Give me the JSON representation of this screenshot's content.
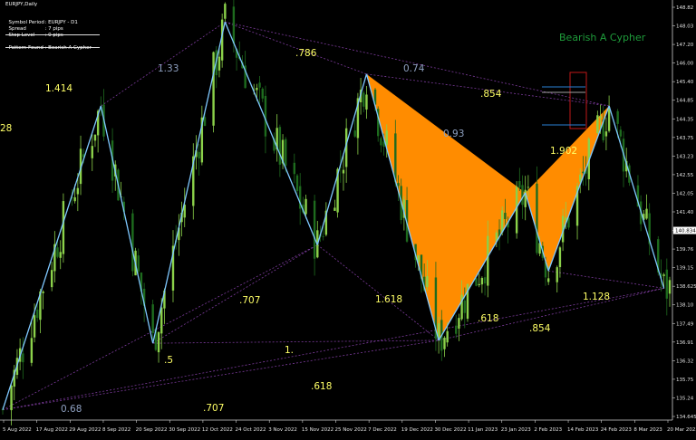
{
  "window": {
    "symbol_title": "EURJPY,Daily"
  },
  "info_panel": {
    "line1_label": "Symbol Period",
    "line1_value": ": EURJPY - D1",
    "line2_label": "Spread",
    "line2_value": ": 7 pips",
    "line3_label": "Stop Level",
    "line3_value": ": 0 pips",
    "line4_label": "Pattern Found",
    "line4_value": ": Bearish A Cypher"
  },
  "pattern_title": "Bearish A Cypher",
  "colors": {
    "background": "#000000",
    "candle_up": "#8bd14a",
    "candle_down": "#1e6b1e",
    "zigzag": "#7fc8ff",
    "pattern_fill": "#ff8c00",
    "fib_label": "#ffff66",
    "ratio_gray": "#8ea0c0",
    "dotted_line": "#7a3a9a",
    "title_green": "#1e9b3a"
  },
  "chart_data": {
    "type": "candlestick",
    "symbol": "EURJPY",
    "timeframe": "Daily",
    "ylim": [
      134.645,
      149.16
    ],
    "y_ticks": [
      148.82,
      148.03,
      147.2,
      146.0,
      145.4,
      144.85,
      144.35,
      143.75,
      143.23,
      142.55,
      142.05,
      141.4,
      140.834,
      139.76,
      139.15,
      138.625,
      138.1,
      137.49,
      136.91,
      136.32,
      135.75,
      135.24,
      134.645
    ],
    "y_tick_labels": [
      "148.82",
      "148.03",
      "147.20",
      "146.00",
      "145.40",
      "144.85",
      "144.35",
      "143.75",
      "143.23",
      "142.55",
      "142.05",
      "141.40",
      "140.834",
      "139.76",
      "139.15",
      "138.625",
      "138.10",
      "137.49",
      "136.91",
      "136.32",
      "135.75",
      "135.24",
      "134.645"
    ],
    "current_price": "140.834",
    "x_labels": [
      "5 Aug 2022",
      "17 Aug 2022",
      "29 Aug 2022",
      "8 Sep 2022",
      "20 Sep 2022",
      "30 Sep 2022",
      "12 Oct 2022",
      "24 Oct 2022",
      "3 Nov 2022",
      "15 Nov 2022",
      "25 Nov 2022",
      "7 Dec 2022",
      "19 Dec 2022",
      "30 Dec 2022",
      "11 Jan 2023",
      "23 Jan 2023",
      "2 Feb 2023",
      "14 Feb 2023",
      "24 Feb 2023",
      "8 Mar 2023",
      "20 Mar 2023"
    ],
    "zigzag": [
      {
        "date": "5 Aug 2022",
        "price": 135.0
      },
      {
        "date": "8 Sep 2022",
        "price": 145.5
      },
      {
        "date": "26 Sep 2022",
        "price": 137.3
      },
      {
        "date": "21 Oct 2022",
        "price": 148.4
      },
      {
        "date": "22 Nov 2022",
        "price": 140.7
      },
      {
        "date": "9 Dec 2022",
        "price": 146.6
      },
      {
        "date": "3 Jan 2023",
        "price": 137.4
      },
      {
        "date": "2 Feb 2023",
        "price": 142.5
      },
      {
        "date": "10 Feb 2023",
        "price": 139.8
      },
      {
        "date": "3 Mar 2023",
        "price": 145.5
      },
      {
        "date": "22 Mar 2023",
        "price": 139.2
      }
    ],
    "fib_labels": [
      "1.414",
      "1.33",
      ".786",
      "0.74",
      ".854",
      "0.93",
      "1.902",
      "1.618",
      ".618",
      ".707",
      ".5",
      "1.",
      ".618",
      ".854",
      "1.128",
      "0.68",
      ".707",
      "28"
    ]
  }
}
